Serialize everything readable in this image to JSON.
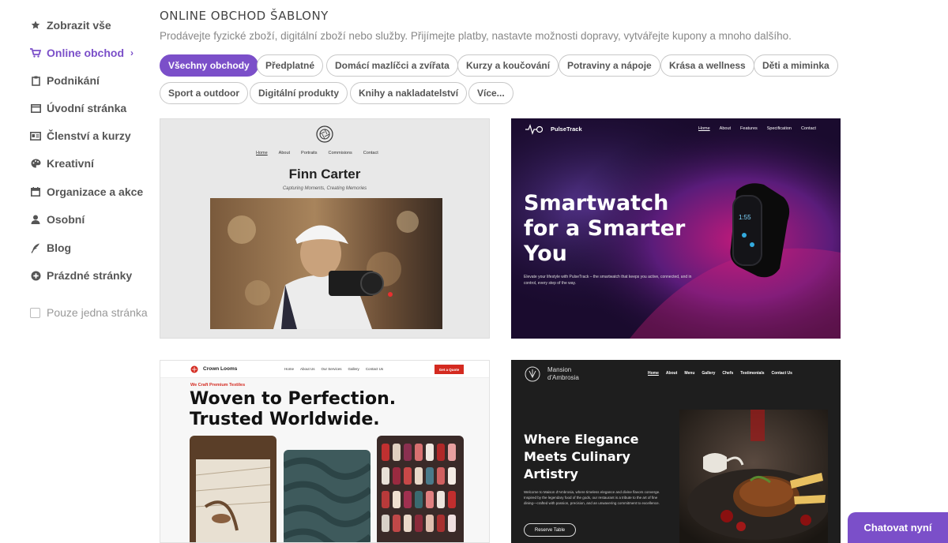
{
  "sidebar": {
    "items": [
      {
        "label": "Zobrazit vše",
        "icon": "star-icon"
      },
      {
        "label": "Online obchod",
        "icon": "cart-icon",
        "active": true
      },
      {
        "label": "Podnikání",
        "icon": "clipboard-icon"
      },
      {
        "label": "Úvodní stránka",
        "icon": "window-icon"
      },
      {
        "label": "Členství a kurzy",
        "icon": "id-card-icon"
      },
      {
        "label": "Kreativní",
        "icon": "palette-icon"
      },
      {
        "label": "Organizace a akce",
        "icon": "calendar-icon"
      },
      {
        "label": "Osobní",
        "icon": "person-icon"
      },
      {
        "label": "Blog",
        "icon": "quill-icon"
      },
      {
        "label": "Prázdné stránky",
        "icon": "plus-circle-icon"
      }
    ],
    "single_page_label": "Pouze jedna stránka"
  },
  "header": {
    "title": "ONLINE OBCHOD ŠABLONY",
    "subtitle": "Prodávejte fyzické zboží, digitální zboží nebo služby. Přijímejte platby, nastavte možnosti dopravy, vytvářejte kupony a mnoho dalšího."
  },
  "filters": [
    "Všechny obchody",
    "Předplatné",
    "Domácí mazlíčci a zvířata",
    "Kurzy a koučování",
    "Potraviny a nápoje",
    "Krása a wellness",
    "Děti a miminka",
    "Sport a outdoor",
    "Digitální produkty",
    "Knihy a nakladatelství",
    "Více..."
  ],
  "templates": {
    "finn": {
      "nav": [
        "Home",
        "About",
        "Portraits",
        "Commisions",
        "Contact"
      ],
      "name": "Finn Carter",
      "tagline": "Capturing Moments, Creating Memories"
    },
    "pulse": {
      "brand": "PulseTrack",
      "nav": [
        "Home",
        "About",
        "Features",
        "Specification",
        "Contact"
      ],
      "headline_1": "Smartwatch",
      "headline_2": "for a Smarter",
      "headline_3": "You",
      "body": "Elevate your lifestyle with PulseTrack – the smartwatch that keeps you active, connected, and in control, every step of the way."
    },
    "crown": {
      "brand": "Crown Looms",
      "nav": [
        "Home",
        "About Us",
        "Our Services",
        "Gallery",
        "Contact Us"
      ],
      "cta": "Get a Quote",
      "kicker": "We Craft Premium Textiles",
      "headline_1": "Woven to Perfection.",
      "headline_2": "Trusted Worldwide."
    },
    "mansion": {
      "brand_1": "Mansion",
      "brand_2": "d'Ambrosia",
      "nav": [
        "Home",
        "About",
        "Menu",
        "Gallery",
        "Chefs",
        "Testimonials",
        "Contact Us"
      ],
      "headline_1": "Where Elegance",
      "headline_2": "Meets Culinary",
      "headline_3": "Artistry",
      "body": "Welcome to Maison d'Ambrosia, where timeless elegance and divine flavors converge. Inspired by the legendary food of the gods, our restaurant is a tribute to the art of fine dining—crafted with passion, precision, and an unwavering commitment to excellence.",
      "cta": "Reserve Table"
    }
  },
  "chat": {
    "label": "Chatovat nyní"
  },
  "colors": {
    "accent": "#7b4fc9",
    "crown_red": "#d42a20"
  }
}
